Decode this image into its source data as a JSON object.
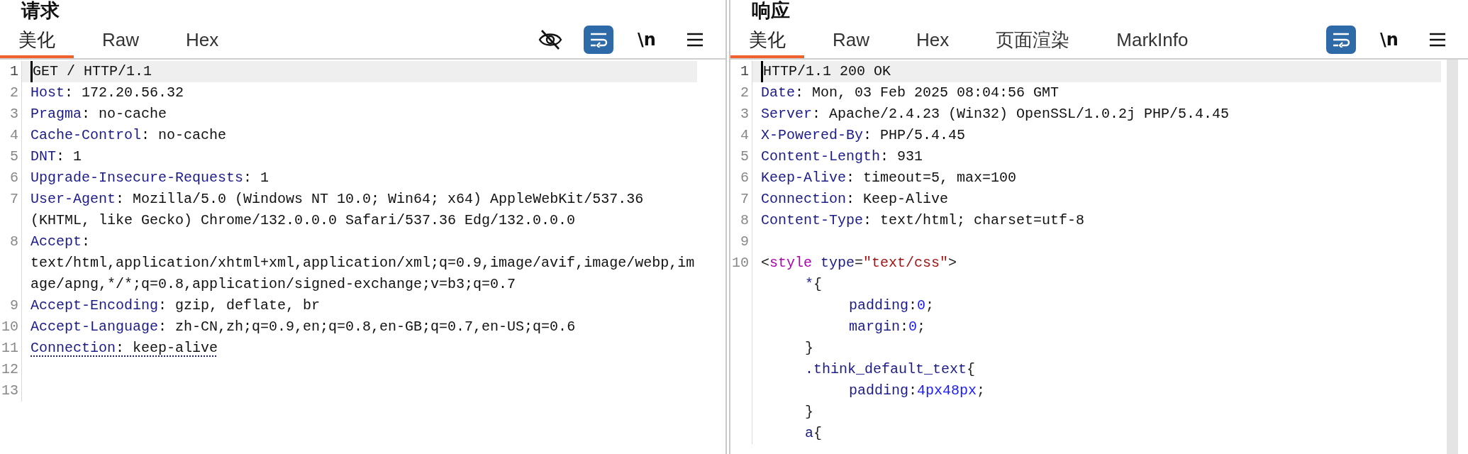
{
  "panes": [
    {
      "title": "请求",
      "tabs": [
        {
          "label": "美化",
          "selected": true
        },
        {
          "label": "Raw",
          "selected": false
        },
        {
          "label": "Hex",
          "selected": false
        }
      ],
      "tools": [
        {
          "kind": "eye-off",
          "on": false
        },
        {
          "kind": "wrap",
          "on": true
        },
        {
          "kind": "newline",
          "label": "\\n",
          "on": false
        },
        {
          "kind": "menu",
          "on": false
        }
      ],
      "lines": [
        {
          "number": "1",
          "current": true,
          "segments": [
            {
              "kind": "plain",
              "text": "GET / HTTP/1.1"
            }
          ]
        },
        {
          "number": "2",
          "current": false,
          "segments": [
            {
              "kind": "key",
              "text": "Host"
            },
            {
              "kind": "plain",
              "text": ": 172.20.56.32"
            }
          ]
        },
        {
          "number": "3",
          "current": false,
          "segments": [
            {
              "kind": "key",
              "text": "Pragma"
            },
            {
              "kind": "plain",
              "text": ": no-cache"
            }
          ]
        },
        {
          "number": "4",
          "current": false,
          "segments": [
            {
              "kind": "key",
              "text": "Cache-Control"
            },
            {
              "kind": "plain",
              "text": ": no-cache"
            }
          ]
        },
        {
          "number": "5",
          "current": false,
          "segments": [
            {
              "kind": "key",
              "text": "DNT"
            },
            {
              "kind": "plain",
              "text": ": 1"
            }
          ]
        },
        {
          "number": "6",
          "current": false,
          "segments": [
            {
              "kind": "key",
              "text": "Upgrade-Insecure-Requests"
            },
            {
              "kind": "plain",
              "text": ": 1"
            }
          ]
        },
        {
          "number": "7",
          "current": false,
          "segments": [
            {
              "kind": "key",
              "text": "User-Agent"
            },
            {
              "kind": "plain",
              "text": ": Mozilla/5.0 (Windows NT 10.0; Win64; x64) AppleWebKit/537.36 (KHTML, like Gecko) Chrome/132.0.0.0 Safari/537.36 Edg/132.0.0.0"
            }
          ]
        },
        {
          "number": "8",
          "current": false,
          "segments": [
            {
              "kind": "key",
              "text": "Accept"
            },
            {
              "kind": "plain",
              "text": ": text/html,application/xhtml+xml,application/xml;q=0.9,image/avif,image/webp,image/apng,*/*;q=0.8,application/signed-exchange;v=b3;q=0.7"
            }
          ]
        },
        {
          "number": "9",
          "current": false,
          "segments": [
            {
              "kind": "key",
              "text": "Accept-Encoding"
            },
            {
              "kind": "plain",
              "text": ": gzip, deflate, br"
            }
          ]
        },
        {
          "number": "10",
          "current": false,
          "segments": [
            {
              "kind": "key",
              "text": "Accept-Language"
            },
            {
              "kind": "plain",
              "text": ": zh-CN,zh;q=0.9,en;q=0.8,en-GB;q=0.7,en-US;q=0.6"
            }
          ]
        },
        {
          "number": "11",
          "current": false,
          "underlined": true,
          "segments": [
            {
              "kind": "key",
              "text": "Connection"
            },
            {
              "kind": "plain",
              "text": ": keep-alive"
            }
          ]
        },
        {
          "number": "12",
          "current": false
        },
        {
          "number": "13",
          "current": false
        }
      ]
    },
    {
      "title": "响应",
      "tabs": [
        {
          "label": "美化",
          "selected": true
        },
        {
          "label": "Raw",
          "selected": false
        },
        {
          "label": "Hex",
          "selected": false
        },
        {
          "label": "页面渲染",
          "selected": false
        },
        {
          "label": "MarkInfo",
          "selected": false
        }
      ],
      "tools": [
        {
          "kind": "wrap",
          "on": true
        },
        {
          "kind": "newline",
          "label": "\\n",
          "on": false
        },
        {
          "kind": "menu",
          "on": false
        }
      ],
      "lines": [
        {
          "number": "1",
          "current": true,
          "segments": [
            {
              "kind": "plain",
              "text": "HTTP/1.1 200 OK"
            }
          ]
        },
        {
          "number": "2",
          "current": false,
          "segments": [
            {
              "kind": "key",
              "text": "Date"
            },
            {
              "kind": "plain",
              "text": ": Mon, 03 Feb 2025 08:04:56 GMT"
            }
          ]
        },
        {
          "number": "3",
          "current": false,
          "segments": [
            {
              "kind": "key",
              "text": "Server"
            },
            {
              "kind": "plain",
              "text": ": Apache/2.4.23 (Win32) OpenSSL/1.0.2j PHP/5.4.45"
            }
          ]
        },
        {
          "number": "4",
          "current": false,
          "segments": [
            {
              "kind": "key",
              "text": "X-Powered-By"
            },
            {
              "kind": "plain",
              "text": ": PHP/5.4.45"
            }
          ]
        },
        {
          "number": "5",
          "current": false,
          "segments": [
            {
              "kind": "key",
              "text": "Content-Length"
            },
            {
              "kind": "plain",
              "text": ": 931"
            }
          ]
        },
        {
          "number": "6",
          "current": false,
          "segments": [
            {
              "kind": "key",
              "text": "Keep-Alive"
            },
            {
              "kind": "plain",
              "text": ": timeout=5, max=100"
            }
          ]
        },
        {
          "number": "7",
          "current": false,
          "segments": [
            {
              "kind": "key",
              "text": "Connection"
            },
            {
              "kind": "plain",
              "text": ": Keep-Alive"
            }
          ]
        },
        {
          "number": "8",
          "current": false,
          "segments": [
            {
              "kind": "key",
              "text": "Content-Type"
            },
            {
              "kind": "plain",
              "text": ": text/html; charset=utf-8"
            }
          ]
        },
        {
          "number": "9",
          "current": false
        },
        {
          "number": "10",
          "current": false,
          "segments": [
            {
              "kind": "punct",
              "text": "<"
            },
            {
              "kind": "tag",
              "text": "style"
            },
            {
              "kind": "attr",
              "text": " type"
            },
            {
              "kind": "punct",
              "text": "="
            },
            {
              "kind": "string",
              "text": "\"text/css\""
            },
            {
              "kind": "punct",
              "text": ">"
            }
          ],
          "children": [
            {
              "segments": [
                {
                  "kind": "key",
                  "text": "*"
                },
                {
                  "kind": "punct",
                  "text": "{"
                }
              ],
              "children": [
                {
                  "segments": [
                    {
                      "kind": "key",
                      "text": "padding"
                    },
                    {
                      "kind": "punct",
                      "text": ":"
                    },
                    {
                      "kind": "number",
                      "text": "0"
                    },
                    {
                      "kind": "punct",
                      "text": ";"
                    }
                  ]
                },
                {
                  "segments": [
                    {
                      "kind": "key",
                      "text": "margin"
                    },
                    {
                      "kind": "punct",
                      "text": ":"
                    },
                    {
                      "kind": "number",
                      "text": "0"
                    },
                    {
                      "kind": "punct",
                      "text": ";"
                    }
                  ]
                }
              ]
            },
            {
              "segments": [
                {
                  "kind": "punct",
                  "text": "}"
                }
              ]
            },
            {
              "segments": [
                {
                  "kind": "key",
                  "text": ".think_default_text"
                },
                {
                  "kind": "punct",
                  "text": "{"
                }
              ],
              "children": [
                {
                  "segments": [
                    {
                      "kind": "key",
                      "text": "padding"
                    },
                    {
                      "kind": "punct",
                      "text": ":"
                    },
                    {
                      "kind": "number",
                      "text": "4px48px"
                    },
                    {
                      "kind": "punct",
                      "text": ";"
                    }
                  ]
                }
              ]
            },
            {
              "segments": [
                {
                  "kind": "punct",
                  "text": "}"
                }
              ]
            },
            {
              "segments": [
                {
                  "kind": "key",
                  "text": "a"
                },
                {
                  "kind": "punct",
                  "text": "{"
                }
              ]
            }
          ]
        }
      ]
    }
  ]
}
